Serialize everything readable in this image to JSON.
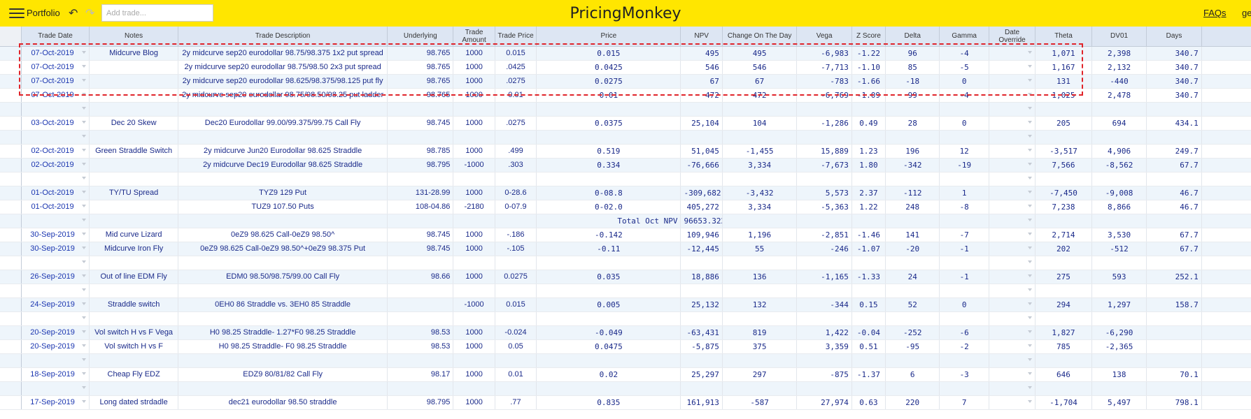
{
  "app": {
    "brand": "PricingMonkey",
    "portfolio_label": "Portfolio",
    "add_trade_placeholder": "Add trade...",
    "faqs_label": "FAQs",
    "user_truncated": "geo"
  },
  "icons": {
    "menu": "hamburger-menu-icon",
    "undo": "undo-arrow-icon",
    "redo": "redo-arrow-icon",
    "dropdown": "chevron-down-icon"
  },
  "colors": {
    "topbar": "#ffe600",
    "header": "#dde6f3",
    "band": "#eef5fb",
    "selection": "#e0242a",
    "link_text": "#1a35b0"
  },
  "columns": [
    "Trade Date",
    "Notes",
    "Trade Description",
    "Underlying",
    "Trade Amount",
    "Trade Price",
    "Price",
    "NPV",
    "Change On The Day",
    "Vega",
    "Z Score",
    "Delta",
    "Gamma",
    "Date Override",
    "Theta",
    "DV01",
    "Days"
  ],
  "rows": [
    {
      "date": "07-Oct-2019",
      "notes": "Midcurve Blog",
      "desc": "2y midcurve sep20 eurodollar 98.75/98.375 1x2 put spread",
      "underlying": "98.765",
      "amount": "1000",
      "trade_price": "0.015",
      "price": "0.015",
      "npv": "495",
      "change": "495",
      "vega": "-6,983",
      "z": "-1.22",
      "delta": "96",
      "gamma": "-4",
      "theta": "1,071",
      "dv01": "2,398",
      "days": "340.7"
    },
    {
      "date": "07-Oct-2019",
      "notes": "",
      "desc": "2y midcurve sep20 eurodollar 98.75/98.50 2x3 put spread",
      "underlying": "98.765",
      "amount": "1000",
      "trade_price": ".0425",
      "price": "0.0425",
      "npv": "546",
      "change": "546",
      "vega": "-7,713",
      "z": "-1.10",
      "delta": "85",
      "gamma": "-5",
      "theta": "1,167",
      "dv01": "2,132",
      "days": "340.7"
    },
    {
      "date": "07-Oct-2019",
      "notes": "",
      "desc": "2y midcurve sep20 eurodollar 98.625/98.375/98.125 put fly",
      "underlying": "98.765",
      "amount": "1000",
      "trade_price": ".0275",
      "price": "0.0275",
      "npv": "67",
      "change": "67",
      "vega": "-783",
      "z": "-1.66",
      "delta": "-18",
      "gamma": "0",
      "theta": "131",
      "dv01": "-440",
      "days": "340.7"
    },
    {
      "date": "07-Oct-2019",
      "notes": "",
      "desc": "2y midcurve sep20 eurodollar 98.75/98.50/98.25 put ladder",
      "underlying": "98.765",
      "amount": "1000",
      "trade_price": "0.01",
      "price": "0.01",
      "npv": "472",
      "change": "472",
      "vega": "-6,769",
      "z": "-1.09",
      "delta": "99",
      "gamma": "-4",
      "theta": "1,025",
      "dv01": "2,478",
      "days": "340.7"
    },
    {
      "blank": true
    },
    {
      "date": "03-Oct-2019",
      "notes": "Dec 20 Skew",
      "desc": "Dec20 Eurodollar 99.00/99.375/99.75 Call Fly",
      "underlying": "98.745",
      "amount": "1000",
      "trade_price": ".0275",
      "price": "0.0375",
      "npv": "25,104",
      "change": "104",
      "vega": "-1,286",
      "z": "0.49",
      "delta": "28",
      "gamma": "0",
      "theta": "205",
      "dv01": "694",
      "days": "434.1"
    },
    {
      "blank": true
    },
    {
      "date": "02-Oct-2019",
      "notes": "Green Straddle Switch",
      "desc": "2y midcurve Jun20 Eurodollar 98.625 Straddle",
      "underlying": "98.785",
      "amount": "1000",
      "trade_price": ".499",
      "price": "0.519",
      "npv": "51,045",
      "change": "-1,455",
      "vega": "15,889",
      "z": "1.23",
      "delta": "196",
      "gamma": "12",
      "theta": "-3,517",
      "dv01": "4,906",
      "days": "249.7"
    },
    {
      "date": "02-Oct-2019",
      "notes": "",
      "desc": "2y midcurve Dec19 Eurodollar 98.625 Straddle",
      "underlying": "98.795",
      "amount": "-1000",
      "trade_price": ".303",
      "price": "0.334",
      "npv": "-76,666",
      "change": "3,334",
      "vega": "-7,673",
      "z": "1.80",
      "delta": "-342",
      "gamma": "-19",
      "theta": "7,566",
      "dv01": "-8,562",
      "days": "67.7"
    },
    {
      "blank": true
    },
    {
      "date": "01-Oct-2019",
      "notes": "TY/TU Spread",
      "desc": "TYZ9 129 Put",
      "underlying": "131-28.99",
      "amount": "1000",
      "trade_price": "0-28.6",
      "price": "0-08.8",
      "npv": "-309,682",
      "change": "-3,432",
      "vega": "5,573",
      "z": "2.37",
      "delta": "-112",
      "gamma": "1",
      "theta": "-7,450",
      "dv01": "-9,008",
      "days": "46.7"
    },
    {
      "date": "01-Oct-2019",
      "notes": "",
      "desc": "TUZ9 107.50 Puts",
      "underlying": "108-04.86",
      "amount": "-2180",
      "trade_price": "0-07.9",
      "price": "0-02.0",
      "npv": "405,272",
      "change": "3,334",
      "vega": "-5,363",
      "z": "1.22",
      "delta": "248",
      "gamma": "-8",
      "theta": "7,238",
      "dv01": "8,866",
      "days": "46.7"
    },
    {
      "total": true,
      "label": "Total Oct NPV",
      "value": "96653.322"
    },
    {
      "date": "30-Sep-2019",
      "notes": "Mid curve Lizard",
      "desc": "0eZ9 98.625 Call-0eZ9 98.50^",
      "underlying": "98.745",
      "amount": "1000",
      "trade_price": "-.186",
      "price": "-0.142",
      "npv": "109,946",
      "change": "1,196",
      "vega": "-2,851",
      "z": "-1.46",
      "delta": "141",
      "gamma": "-7",
      "theta": "2,714",
      "dv01": "3,530",
      "days": "67.7"
    },
    {
      "date": "30-Sep-2019",
      "notes": "Midcurve Iron Fly",
      "desc": "0eZ9 98.625 Call-0eZ9 98.50^+0eZ9 98.375 Put",
      "underlying": "98.745",
      "amount": "1000",
      "trade_price": "-.105",
      "price": "-0.11",
      "npv": "-12,445",
      "change": "55",
      "vega": "-246",
      "z": "-1.07",
      "delta": "-20",
      "gamma": "-1",
      "theta": "202",
      "dv01": "-512",
      "days": "67.7"
    },
    {
      "blank": true
    },
    {
      "date": "26-Sep-2019",
      "notes": "Out of line EDM Fly",
      "desc": "EDM0 98.50/98.75/99.00 Call Fly",
      "underlying": "98.66",
      "amount": "1000",
      "trade_price": "0.0275",
      "price": "0.035",
      "npv": "18,886",
      "change": "136",
      "vega": "-1,165",
      "z": "-1.33",
      "delta": "24",
      "gamma": "-1",
      "theta": "275",
      "dv01": "593",
      "days": "252.1"
    },
    {
      "blank": true
    },
    {
      "date": "24-Sep-2019",
      "notes": "Straddle switch",
      "desc": "0EH0 86 Straddle vs. 3EH0 85 Straddle",
      "underlying": "",
      "amount": "-1000",
      "trade_price": "0.015",
      "price": "0.005",
      "npv": "25,132",
      "change": "132",
      "vega": "-344",
      "z": "0.15",
      "delta": "52",
      "gamma": "0",
      "theta": "294",
      "dv01": "1,297",
      "days": "158.7"
    },
    {
      "blank": true
    },
    {
      "date": "20-Sep-2019",
      "notes": "Vol switch H vs F Vega",
      "desc": "H0 98.25 Straddle- 1.27*F0 98.25 Straddle",
      "underlying": "98.53",
      "amount": "1000",
      "trade_price": "-0.024",
      "price": "-0.049",
      "npv": "-63,431",
      "change": "819",
      "vega": "1,422",
      "z": "-0.04",
      "delta": "-252",
      "gamma": "-6",
      "theta": "1,827",
      "dv01": "-6,290",
      "days": ""
    },
    {
      "date": "20-Sep-2019",
      "notes": "Vol switch H vs F",
      "desc": "H0 98.25 Straddle- F0 98.25 Straddle",
      "underlying": "98.53",
      "amount": "1000",
      "trade_price": "0.05",
      "price": "0.0475",
      "npv": "-5,875",
      "change": "375",
      "vega": "3,359",
      "z": "0.51",
      "delta": "-95",
      "gamma": "-2",
      "theta": "785",
      "dv01": "-2,365",
      "days": ""
    },
    {
      "blank": true
    },
    {
      "date": "18-Sep-2019",
      "notes": "Cheap Fly EDZ",
      "desc": "EDZ9 80/81/82 Call Fly",
      "underlying": "98.17",
      "amount": "1000",
      "trade_price": "0.01",
      "price": "0.02",
      "npv": "25,297",
      "change": "297",
      "vega": "-875",
      "z": "-1.37",
      "delta": "6",
      "gamma": "-3",
      "theta": "646",
      "dv01": "138",
      "days": "70.1"
    },
    {
      "blank": true
    },
    {
      "date": "17-Sep-2019",
      "notes": "Long dated strdadle",
      "desc": "dec21 eurodollar 98.50 straddle",
      "underlying": "98.795",
      "amount": "1000",
      "trade_price": ".77",
      "price": "0.835",
      "npv": "161,913",
      "change": "-587",
      "vega": "27,974",
      "z": "0.63",
      "delta": "220",
      "gamma": "7",
      "theta": "-1,704",
      "dv01": "5,497",
      "days": "798.1"
    }
  ]
}
